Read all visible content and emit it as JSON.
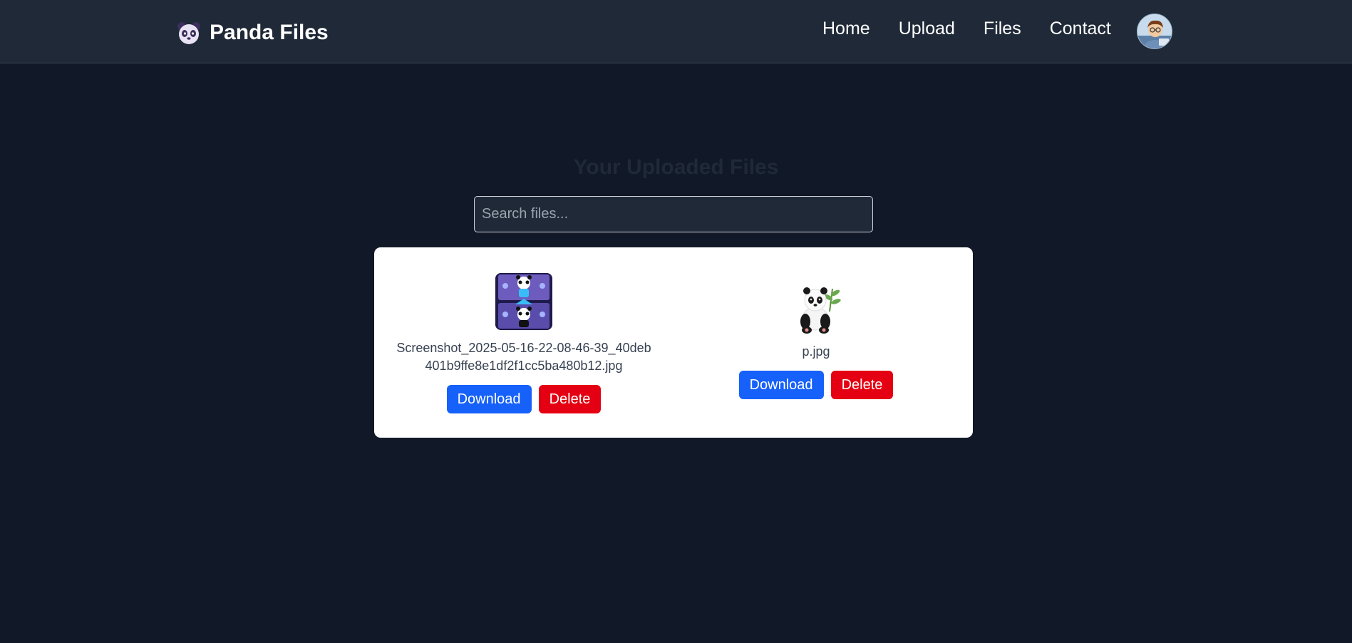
{
  "brand": {
    "name": "Panda Files",
    "icon": "panda-face-icon"
  },
  "nav": {
    "items": [
      {
        "label": "Home"
      },
      {
        "label": "Upload"
      },
      {
        "label": "Files"
      },
      {
        "label": "Contact"
      }
    ],
    "avatar": "user-avatar"
  },
  "page": {
    "title": "Your Uploaded Files"
  },
  "search": {
    "placeholder": "Search files..."
  },
  "files": [
    {
      "name": "Screenshot_2025-05-16-22-08-46-39_40deb401b9ffe8e1df2f1cc5ba480b12.jpg",
      "download_label": "Download",
      "delete_label": "Delete"
    },
    {
      "name": "p.jpg",
      "download_label": "Download",
      "delete_label": "Delete"
    }
  ],
  "colors": {
    "background": "#111827",
    "navbar": "#1f2937",
    "download": "#1661fa",
    "delete": "#e40012"
  }
}
